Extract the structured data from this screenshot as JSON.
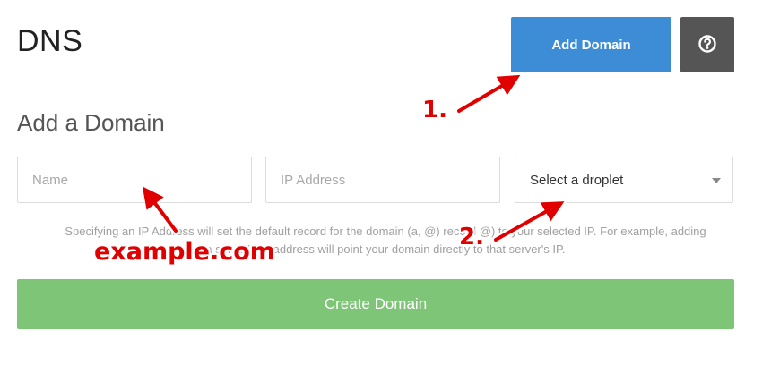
{
  "header": {
    "title": "DNS",
    "add_domain_label": "Add Domain",
    "help_icon": "question-circle-icon"
  },
  "form": {
    "section_title": "Add a Domain",
    "name_placeholder": "Name",
    "ip_placeholder": "IP Address",
    "droplet_select_value": "Select a droplet",
    "help_text": "Specifying an IP Address will set the default record for the domain (a, @) record @) to your selected IP. For example, adding a server's IP address will point your domain directly to that server's IP.",
    "create_label": "Create Domain"
  },
  "annotations": {
    "step1": "1.",
    "step2": "2.",
    "example": "example.com"
  },
  "colors": {
    "primary": "#3d8dd6",
    "help_button": "#555555",
    "create_button": "#7ec577",
    "annotation": "#e00000"
  }
}
